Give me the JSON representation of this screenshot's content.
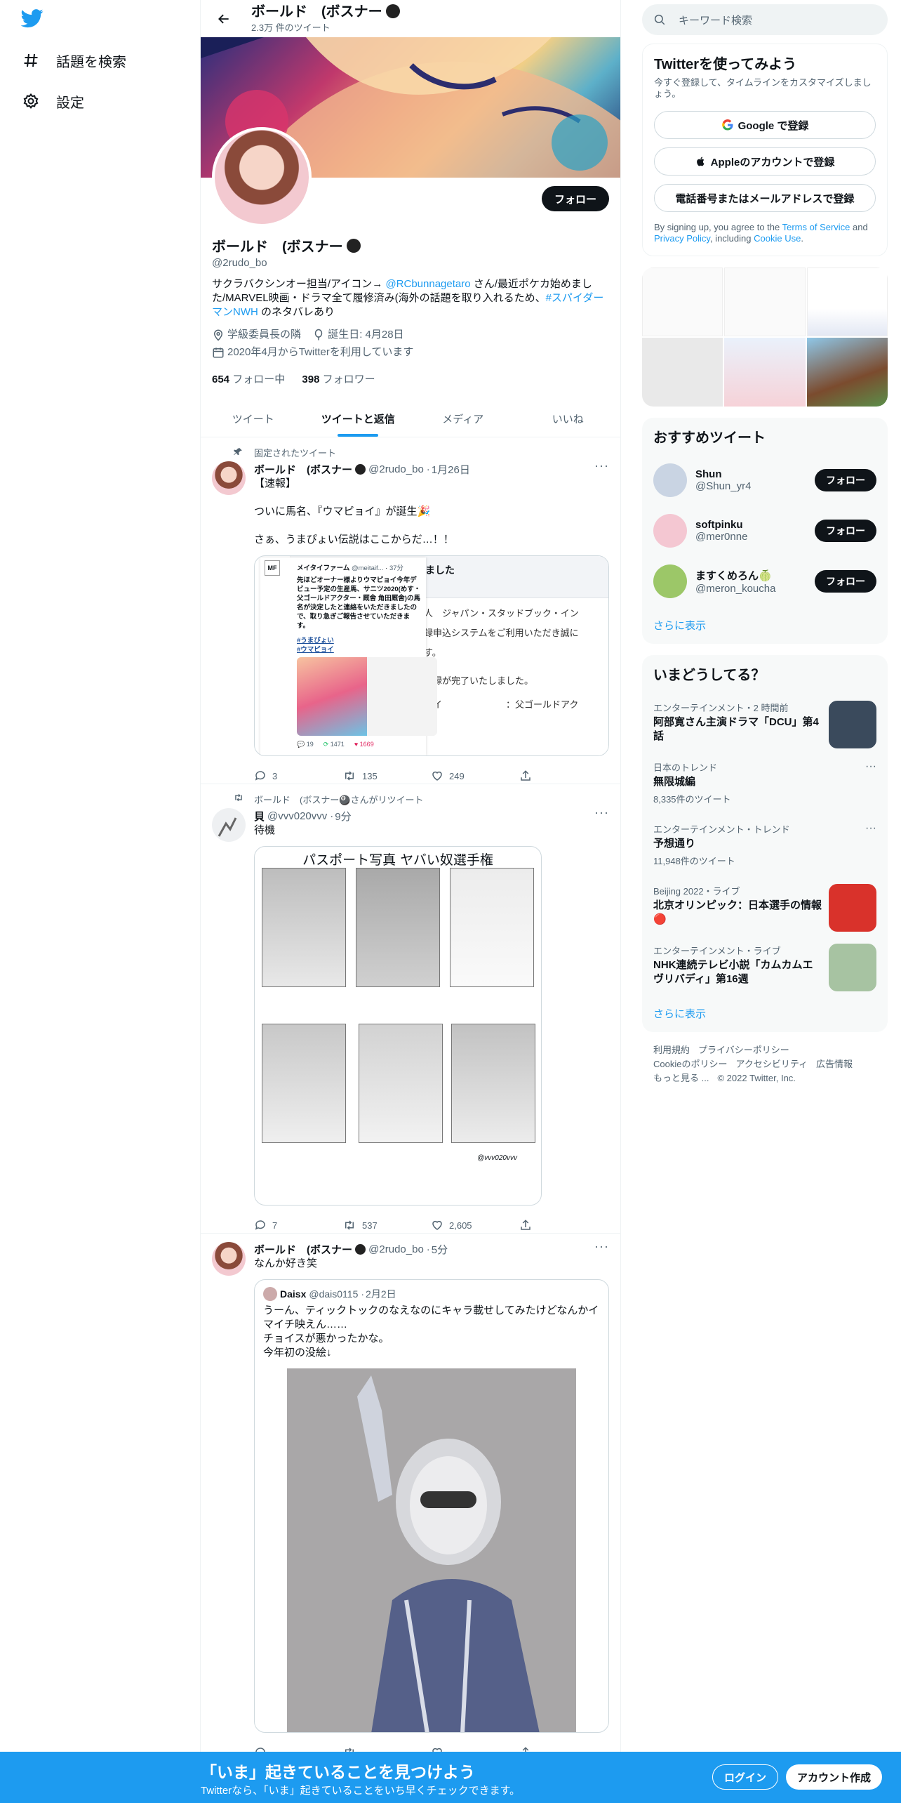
{
  "nav": {
    "explore_label": "話題を検索",
    "settings_label": "設定"
  },
  "profile": {
    "header_name": "ボールド　(ボスナー",
    "header_tweets": "2.3万 件のツイート",
    "name": "ボールド　(ボスナー",
    "handle": "@2rudo_bo",
    "follow_label": "フォロー",
    "bio_1": "サクラバクシンオー担当/アイコン→ ",
    "bio_mention": "@RCbunnagetaro",
    "bio_2": " さん/最近ポケカ始めました/MARVEL映画・ドラマ全て履修済み(海外の話題を取り入れるため、",
    "bio_hashtag": "#スパイダーマンNWH",
    "bio_3": " のネタバレあり",
    "location": "学級委員長の隣",
    "birthday": "誕生日: 4月28日",
    "joined": "2020年4月からTwitterを利用しています",
    "following_count": "654",
    "following_label": "フォロー中",
    "followers_count": "398",
    "followers_label": "フォロワー"
  },
  "tabs": [
    {
      "label": "ツイート"
    },
    {
      "label": "ツイートと返信"
    },
    {
      "label": "メディア"
    },
    {
      "label": "いいね"
    }
  ],
  "tweets": [
    {
      "context": "固定されたツイート",
      "name": "ボールド　(ボスナー",
      "handle": "@2rudo_bo",
      "time": "1月26日",
      "text": "【速報】\n\nついに馬名、『ウマピョイ』が誕生🎉\n\nさぁ、うまぴょい伝説はここからだ…！！",
      "quote": {
        "name": "メイタイファーム",
        "handle": "@meitaif...",
        "time": "37分",
        "text": "先ほどオーナー様よりウマピョイ今年デビュー予定の生産馬、サニツ2020(めす・父ゴールドアクター・厩舎 角田厩舎)の馬名が決定したと連絡をいただきましたので、取り急ぎご報告させていただきます。",
        "tag1": "#うまぴょい",
        "tag2": "#ウマピョイ",
        "card_title": "完了しました",
        "card_l1": "人　ジャパン・スタッドブック・イン",
        "card_l2": "録申込システムをご利用いただき誠に",
        "card_l3": "す。",
        "card_l4": "登録が完了いたしました。",
        "card_l5": "ヨイ　　　　　　　：父ゴールドアク",
        "mini_replies": "19",
        "mini_retweets": "1471",
        "mini_likes": "1669"
      },
      "replies": "3",
      "retweets": "135",
      "likes": "249"
    },
    {
      "context": "ボールド　(ボスナー🎱さんがリツイート",
      "name": "貝",
      "handle": "@vvv020vvv",
      "time": "9分",
      "text": "待機",
      "image_title": "パスポート写真 ヤバい奴選手権",
      "image_sign": "@vvv020vvv",
      "replies": "7",
      "retweets": "537",
      "likes": "2,605"
    },
    {
      "name": "ボールド　(ボスナー",
      "handle": "@2rudo_bo",
      "time": "5分",
      "text": "なんか好き笑",
      "quote": {
        "name": "Daisx",
        "handle": "@dais0115",
        "time": "2月2日",
        "text": "うーん、ティックトックのなえなのにキャラ載せしてみたけどなんかイマイチ映えん……\nチョイスが悪かったかな。\n今年初の没絵↓"
      }
    }
  ],
  "search": {
    "placeholder": "キーワード検索"
  },
  "signup": {
    "title": "Twitterを使ってみよう",
    "desc": "今すぐ登録して、タイムラインをカスタマイズしましょう。",
    "google": "Google で登録",
    "apple": "Appleのアカウントで登録",
    "phone": "電話番号またはメールアドレスで登録",
    "terms_1": "By signing up, you agree to the ",
    "terms_link1": "Terms of Service",
    "terms_2": " and ",
    "terms_link2": "Privacy Policy",
    "terms_3": ", including ",
    "terms_link3": "Cookie Use",
    "terms_4": "."
  },
  "recommend": {
    "title": "おすすめツイート",
    "users": [
      {
        "name": "Shun",
        "handle": "@Shun_yr4",
        "follow": "フォロー",
        "color": "#c9d4e3"
      },
      {
        "name": "softpinku",
        "handle": "@mer0nne",
        "follow": "フォロー",
        "color": "#f4c7d2"
      },
      {
        "name": "ますくめろん🍈",
        "handle": "@meron_koucha",
        "follow": "フォロー",
        "color": "#9cc768"
      }
    ],
    "more": "さらに表示"
  },
  "trends": {
    "title": "いまどうしてる？",
    "items": [
      {
        "cat": "エンターテインメント・2 時間前",
        "title": "阿部寛さん主演ドラマ「DCU」第4話",
        "count": "",
        "thumb": "#3a4a5c"
      },
      {
        "cat": "日本のトレンド",
        "title": "無限城編",
        "count": "8,335件のツイート",
        "thumb": ""
      },
      {
        "cat": "エンターテインメント・トレンド",
        "title": "予想通り",
        "count": "11,948件のツイート",
        "thumb": ""
      },
      {
        "cat": "Beijing 2022・ライブ",
        "title": "北京オリンピック：日本選手の情報🔴",
        "count": "",
        "thumb": "#d9322b"
      },
      {
        "cat": "エンターテインメント・ライブ",
        "title": "NHK連続テレビ小説「カムカムエヴリバディ」第16週",
        "count": "",
        "thumb": "#a7c3a2"
      }
    ],
    "more": "さらに表示"
  },
  "footer": {
    "l1": "利用規約",
    "l2": "プライバシーポリシー",
    "l3": "Cookieのポリシー",
    "l4": "アクセシビリティ",
    "l5": "広告情報",
    "l6": "もっと見る ...",
    "l7": "© 2022 Twitter, Inc."
  },
  "bottombar": {
    "title": "「いま」起きていることを見つけよう",
    "sub": "Twitterなら、「いま」起きていることをいち早くチェックできます。",
    "login": "ログイン",
    "signup": "アカウント作成"
  }
}
